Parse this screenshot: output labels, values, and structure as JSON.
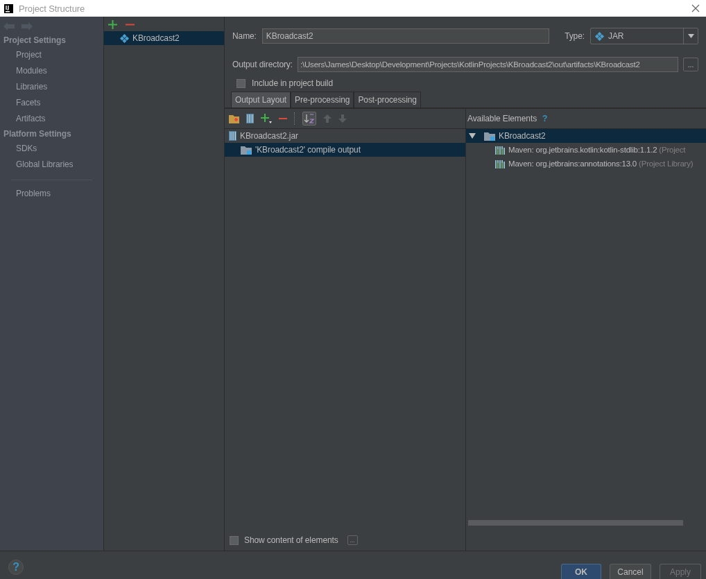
{
  "window": {
    "title": "Project Structure"
  },
  "sidebar": {
    "sections": [
      {
        "heading": "Project Settings",
        "items": [
          {
            "label": "Project",
            "selected": false
          },
          {
            "label": "Modules",
            "selected": false
          },
          {
            "label": "Libraries",
            "selected": false
          },
          {
            "label": "Facets",
            "selected": false
          },
          {
            "label": "Artifacts",
            "selected": false
          }
        ]
      },
      {
        "heading": "Platform Settings",
        "items": [
          {
            "label": "SDKs",
            "selected": false
          },
          {
            "label": "Global Libraries",
            "selected": false
          }
        ]
      }
    ],
    "bottom_items": [
      {
        "label": "Problems",
        "selected": false
      }
    ]
  },
  "artifacts": [
    {
      "label": "KBroadcast2",
      "selected": true
    }
  ],
  "form": {
    "name": {
      "label": "Name:",
      "value": "KBroadcast2"
    },
    "type": {
      "label": "Type:",
      "value": "JAR"
    },
    "output_directory": {
      "label": "Output directory:",
      "value": ":\\Users\\James\\Desktop\\Development\\Projects\\KotlinProjects\\KBroadcast2\\out\\artifacts\\KBroadcast2",
      "browse": "..."
    },
    "include_in_build": {
      "label": "Include in project build",
      "checked": false
    }
  },
  "tabs": [
    {
      "label": "Output Layout",
      "selected": true
    },
    {
      "label": "Pre-processing",
      "selected": false
    },
    {
      "label": "Post-processing",
      "selected": false
    }
  ],
  "output_layout": [
    {
      "label": "KBroadcast2.jar",
      "kind": "jar",
      "selected": false,
      "children": [
        {
          "label": "'KBroadcast2' compile output",
          "kind": "module",
          "selected": true
        }
      ]
    }
  ],
  "available_elements": {
    "title": "Available Elements",
    "help": "?",
    "tree": [
      {
        "label": "KBroadcast2",
        "expanded": true,
        "selected": true,
        "children": [
          {
            "label": "Maven: org.jetbrains.kotlin:kotlin-stdlib:1.1.2",
            "note": "(Project"
          },
          {
            "label": "Maven: org.jetbrains:annotations:13.0",
            "note": "(Project Library)"
          }
        ]
      }
    ]
  },
  "show_content": {
    "label": "Show content of elements",
    "checked": false,
    "more": "..."
  },
  "footer_help": "?",
  "buttons": [
    {
      "label": "OK",
      "kind": "primary",
      "disabled": false
    },
    {
      "label": "Cancel",
      "kind": "normal",
      "disabled": false
    },
    {
      "label": "Apply",
      "kind": "normal",
      "disabled": true
    }
  ]
}
